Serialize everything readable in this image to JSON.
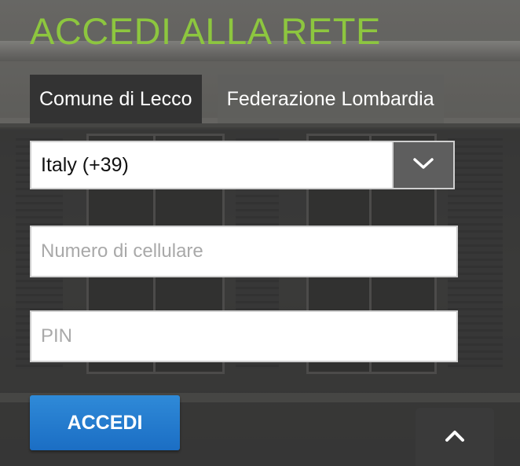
{
  "page": {
    "title": "ACCEDI ALLA RETE"
  },
  "tabs": [
    {
      "label": "Comune di Lecco",
      "active": true
    },
    {
      "label": "Federazione Lombardia",
      "active": false
    }
  ],
  "country_select": {
    "value": "Italy (+39)",
    "icon": "chevron-down-icon"
  },
  "phone_input": {
    "value": "",
    "placeholder": "Numero di cellulare"
  },
  "pin_input": {
    "value": "",
    "placeholder": "PIN"
  },
  "submit": {
    "label": "ACCEDI",
    "color": "#2a7fd1"
  },
  "back_to_top": {
    "icon": "chevron-up-icon"
  },
  "colors": {
    "title": "#8dc63f",
    "active_tab": "#333333"
  }
}
